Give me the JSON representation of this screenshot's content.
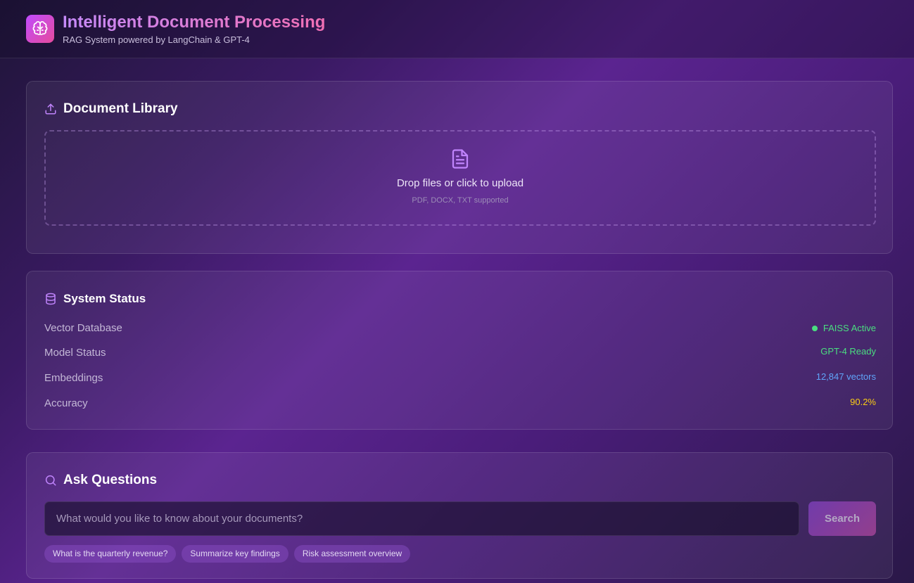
{
  "header": {
    "title": "Intelligent Document Processing",
    "subtitle": "RAG System powered by LangChain & GPT-4",
    "logo_icon": "brain-icon"
  },
  "library": {
    "title": "Document Library",
    "title_icon": "upload-icon",
    "drop_label": "Drop files or click to upload",
    "drop_hint": "PDF, DOCX, TXT supported",
    "drop_icon": "file-text-icon"
  },
  "status": {
    "title": "System Status",
    "title_icon": "database-icon",
    "rows": [
      {
        "label": "Vector Database",
        "value": "FAISS Active",
        "color": "#4ade80",
        "indicator": true
      },
      {
        "label": "Model Status",
        "value": "GPT-4 Ready",
        "color": "#4ade80",
        "indicator": false
      },
      {
        "label": "Embeddings",
        "value": "12,847 vectors",
        "color": "#60a5fa",
        "indicator": false
      },
      {
        "label": "Accuracy",
        "value": "90.2%",
        "color": "#facc15",
        "indicator": false
      }
    ]
  },
  "ask": {
    "title": "Ask Questions",
    "title_icon": "search-icon",
    "placeholder": "What would you like to know about your documents?",
    "value": "",
    "button_label": "Search",
    "suggestions": [
      "What is the quarterly revenue?",
      "Summarize key findings",
      "Risk assessment overview"
    ]
  },
  "colors": {
    "accent": "#c084fc",
    "brand_gradient_start": "#c04bff",
    "brand_gradient_end": "#e64b9c"
  }
}
